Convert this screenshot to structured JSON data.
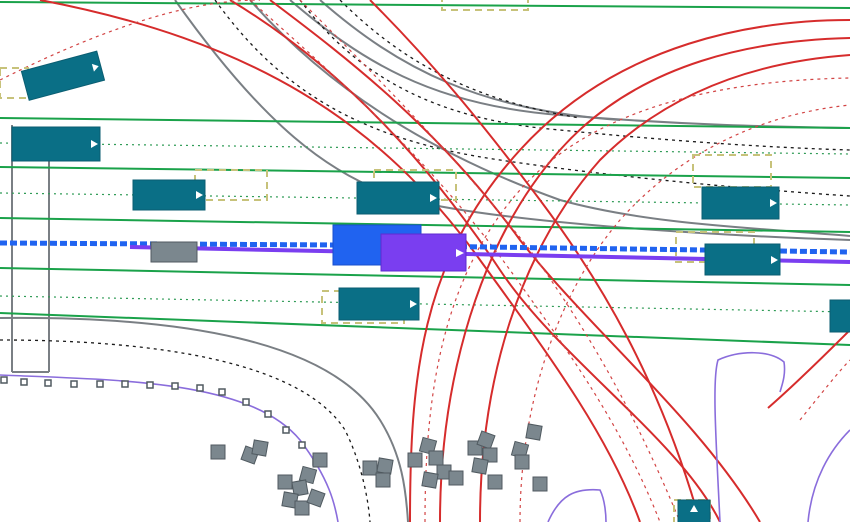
{
  "scene": {
    "type": "driving-scene-bev-map",
    "colors": {
      "background": "#ffffff",
      "lane_line_green": "#1aa24a",
      "lane_center_dotted_green": "#2f9b56",
      "route_red": "#d62c2c",
      "route_red_dotted": "#d24444",
      "road_edge_gray": "#7a7f84",
      "road_edge_black_dotted": "#1a1a1a",
      "ego_planned_blue": "#2063f0",
      "ego_planned_purple": "#7a3ef0",
      "other_vehicle": "#0a6f86",
      "static_object": "#7b878e",
      "lane_boundary_purple": "#8a6ddc",
      "yellow_dashed_box": "#c7c27a",
      "parking_marker": "#505a60"
    },
    "vehicles": [
      {
        "id": "vehicle-1"
      },
      {
        "id": "vehicle-2"
      },
      {
        "id": "vehicle-3"
      },
      {
        "id": "vehicle-4"
      },
      {
        "id": "vehicle-5"
      },
      {
        "id": "vehicle-6"
      },
      {
        "id": "vehicle-7"
      },
      {
        "id": "vehicle-8"
      }
    ],
    "ego": {
      "id": "ego-vehicle"
    },
    "ego_predicted": {
      "id": "ego-predicted"
    },
    "static_count": 33
  }
}
